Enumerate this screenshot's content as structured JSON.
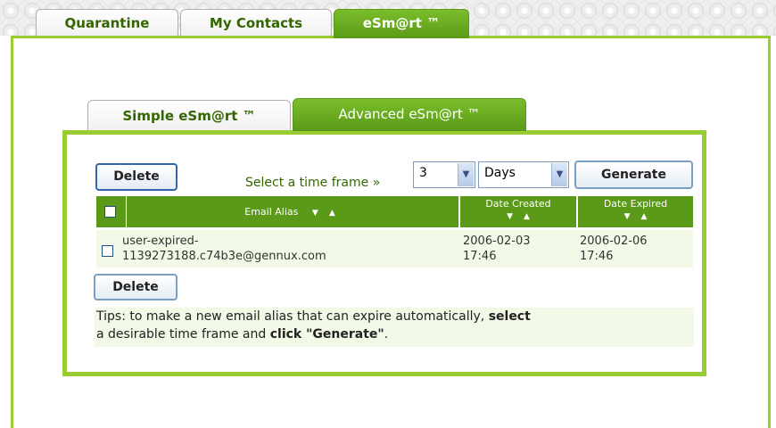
{
  "top_tabs": [
    {
      "label": "Quarantine"
    },
    {
      "label": "My Contacts"
    },
    {
      "label": "eSm@rt ™"
    }
  ],
  "inner_tabs": [
    {
      "label": "Simple eSm@rt ™"
    },
    {
      "label": "Advanced eSm@rt ™"
    }
  ],
  "toolbar": {
    "delete_label": "Delete",
    "time_frame_label": "Select a time frame »",
    "time_value": "3",
    "time_unit": "Days",
    "generate_label": "Generate"
  },
  "table": {
    "headers": {
      "alias": "Email Alias",
      "created": "Date Created",
      "expired": "Date Expired"
    },
    "rows": [
      {
        "alias_line1": "user-expired-",
        "alias_line2": "1139273188.c74b3e@gennux.com",
        "created_date": "2006-02-03",
        "created_time": "17:46",
        "expired_date": "2006-02-06",
        "expired_time": "17:46"
      }
    ]
  },
  "bottom": {
    "delete_label": "Delete"
  },
  "tips": {
    "part1": "Tips: to make a new email alias that can expire automatically, ",
    "bold1": "select",
    "part2": "a desirable time frame and ",
    "bold2": "click \"Generate\"",
    "part3": "."
  },
  "colors": {
    "accent_green": "#5a9a18",
    "frame_green": "#99cc33",
    "row_bg": "#f2f9e6"
  }
}
